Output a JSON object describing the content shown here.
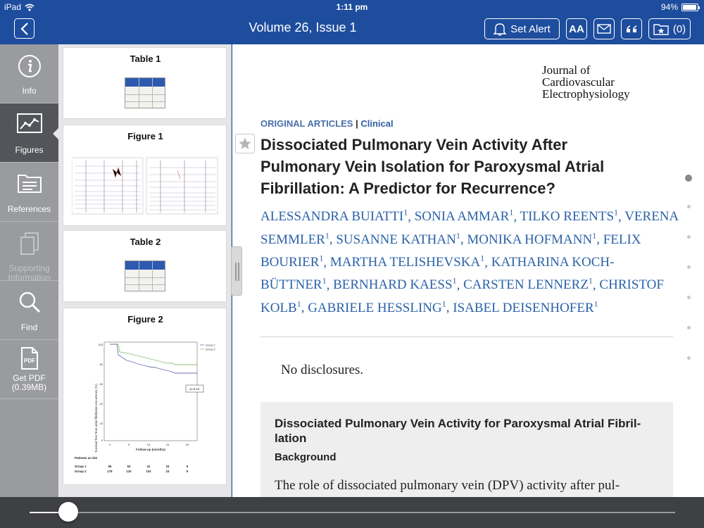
{
  "status": {
    "carrier": "iPad",
    "time": "1:11 pm",
    "battery": "94%",
    "battery_level": 0.94
  },
  "nav": {
    "title": "Volume 26, Issue 1",
    "set_alert": "Set Alert",
    "font_size": "AA",
    "saved_count": "(0)"
  },
  "sidebar": {
    "info": "Info",
    "figures": "Figures",
    "references": "References",
    "supporting": "Supporting Information",
    "find": "Find",
    "pdf": "Get PDF (0.39MB)"
  },
  "thumbnails": [
    {
      "title": "Table 1",
      "kind": "table"
    },
    {
      "title": "Figure 1",
      "kind": "figure"
    },
    {
      "title": "Table 2",
      "kind": "table"
    },
    {
      "title": "Figure 2",
      "kind": "figure"
    }
  ],
  "figure2": {
    "ylabel": "Survival free from atrial fibrillation recurrence (%)",
    "xlabel": "Follow-up (months)",
    "legend": [
      "Group 1",
      "Group 2"
    ],
    "pvalue": "p=0.12",
    "risk_title": "Patients at risk",
    "risk_rows": [
      {
        "label": "Group 1",
        "values": [
          "65",
          "53",
          "41",
          "23",
          "9"
        ]
      },
      {
        "label": "Group 2",
        "values": [
          "178",
          "133",
          "103",
          "23",
          "9"
        ]
      }
    ]
  },
  "article": {
    "journal": [
      "Journal of",
      "Cardiovascular",
      "Electrophysiology"
    ],
    "section": "ORIGINAL ARTICLES",
    "section_sep": "|",
    "subsection": "Clinical",
    "title": "Dissociated Pulmonary Vein Activity After Pulmonary Vein Isolation for Paroxysmal Atrial Fibrillation: A Predictor for Recurrence?",
    "authors": [
      "ALESSANDRA BUIATTI",
      "SONIA AMMAR",
      "TILKO REENTS",
      "VERENA SEMMLER",
      "SUSANNE KATHAN",
      "MONIKA HOFMANN",
      "FELIX BOURIER",
      "MARTHA TELISHEVSKA",
      "KATHARINA KOCH-BÜTTNER",
      "BERNHARD KAESS",
      "CARSTEN LENNERZ",
      "CHRISTOF KOLB",
      "GABRIELE HESSLING",
      "ISABEL DEISENHOFER"
    ],
    "affiliation_mark": "1",
    "disclosure": "No disclosures.",
    "abstract_title": "Dissociated Pulmonary Vein Activity for Paroxysmal Atrial Fibril- lation",
    "abstract_heading": "Background",
    "abstract_text": "The role of dissociated pulmonary vein (DPV) activity after pul-"
  },
  "page_indicator": {
    "count": 7,
    "current": 1
  },
  "reader_slider": {
    "position": 0.06
  },
  "colors": {
    "brand": "#1e4d9e",
    "link": "#2b62a8",
    "sidebar": "#9a9b9f",
    "sidebar_active": "#53555a"
  }
}
